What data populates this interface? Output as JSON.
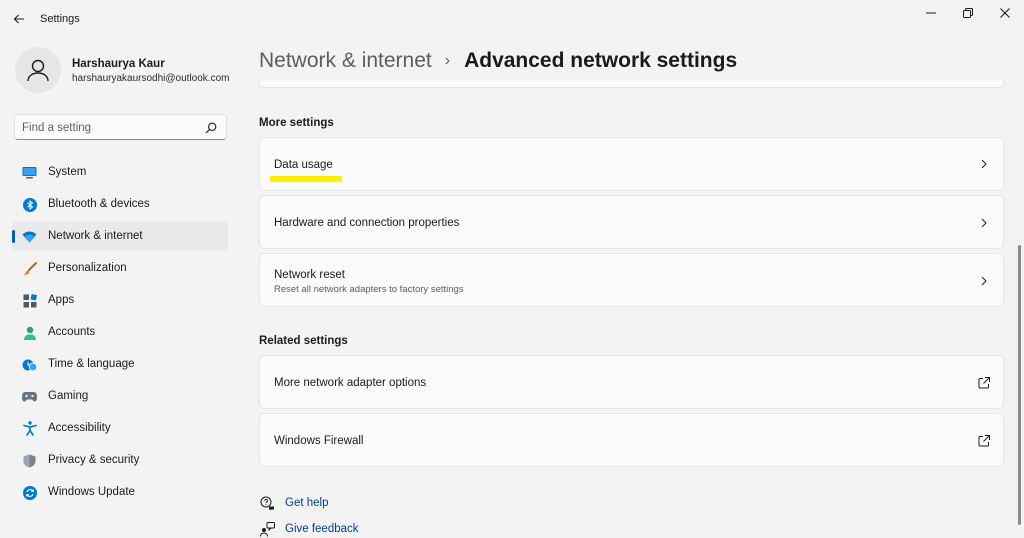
{
  "window": {
    "title": "Settings"
  },
  "profile": {
    "name": "Harshaurya Kaur",
    "email": "harshauryakaursodhi@outlook.com"
  },
  "search": {
    "placeholder": "Find a setting"
  },
  "sidebar": {
    "items": [
      {
        "label": "System",
        "icon": "monitor-icon"
      },
      {
        "label": "Bluetooth & devices",
        "icon": "bluetooth-icon"
      },
      {
        "label": "Network & internet",
        "icon": "wifi-icon",
        "active": true
      },
      {
        "label": "Personalization",
        "icon": "brush-icon"
      },
      {
        "label": "Apps",
        "icon": "apps-icon"
      },
      {
        "label": "Accounts",
        "icon": "person-icon"
      },
      {
        "label": "Time & language",
        "icon": "clock-globe-icon"
      },
      {
        "label": "Gaming",
        "icon": "gamepad-icon"
      },
      {
        "label": "Accessibility",
        "icon": "accessibility-icon"
      },
      {
        "label": "Privacy & security",
        "icon": "shield-icon"
      },
      {
        "label": "Windows Update",
        "icon": "update-icon"
      }
    ]
  },
  "breadcrumb": {
    "parent": "Network & internet",
    "separator": "›",
    "current": "Advanced network settings"
  },
  "more_settings": {
    "title": "More settings",
    "items": [
      {
        "title": "Data usage",
        "subtitle": ""
      },
      {
        "title": "Hardware and connection properties",
        "subtitle": ""
      },
      {
        "title": "Network reset",
        "subtitle": "Reset all network adapters to factory settings"
      }
    ]
  },
  "related_settings": {
    "title": "Related settings",
    "items": [
      {
        "title": "More network adapter options"
      },
      {
        "title": "Windows Firewall"
      }
    ]
  },
  "help": {
    "get_help": "Get help",
    "give_feedback": "Give feedback"
  },
  "colors": {
    "accent": "#005fb8",
    "link": "#003e92",
    "highlight": "#ffee00"
  }
}
